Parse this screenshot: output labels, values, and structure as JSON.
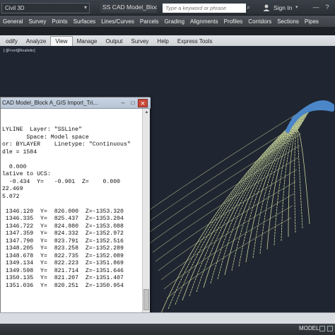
{
  "titlebar": {
    "workspace": "Civil 3D",
    "doc_title": "SS CAD Model_Bloc...",
    "search_placeholder": "Type a keyword or phrase",
    "signin": "Sign In"
  },
  "menubar": {
    "items": [
      "General",
      "Survey",
      "Points",
      "Surfaces",
      "Lines/Curves",
      "Parcels",
      "Grading",
      "Alignments",
      "Profiles",
      "Corridors",
      "Sections",
      "Pipes"
    ]
  },
  "ribbon": {
    "tabs": [
      "odify",
      "Analyze",
      "View",
      "Manage",
      "Output",
      "Survey",
      "Help",
      "Express Tools"
    ],
    "active_tab": "View"
  },
  "viewport": {
    "label": "[-][Front][Realistic]"
  },
  "text_window": {
    "title": "CAD Model_Block A_GIS Import_Tri...",
    "lines": [
      "",
      "",
      "LYLINE  Layer: \"SSLine\"",
      "       Space: Model space",
      "or: BYLAYER    Linetype: \"Continuous\"",
      "dle = 1584",
      "",
      "  0.000",
      "lative to UCS:",
      "  -0.434  Y=   -0.901  Z=    0.000",
      "22.469",
      "5.072",
      "",
      " 1346.120  Y=  826.000  Z=-1353.320",
      " 1346.335  Y=  825.437  Z=-1353.204",
      " 1346.722  Y=  824.880  Z=-1353.088",
      " 1347.359  Y=  824.332  Z=-1352.972",
      " 1347.790  Y=  823.791  Z=-1352.516",
      " 1348.205  Y=  823.258  Z=-1352.289",
      " 1348.678  Y=  822.735  Z=-1352.089",
      " 1349.134  Y=  822.223  Z=-1351.869",
      " 1349.598  Y=  821.714  Z=-1351.646",
      " 1350.135  Y=  821.207  Z=-1351.407",
      " 1351.036  Y=  820.251  Z=-1350.954"
    ]
  },
  "statusbar": {
    "model_label": "MODEL"
  },
  "colors": {
    "viewport_bg": "#1f2631",
    "contour_line": "#c8d49a",
    "highlight_line": "#4b86c8"
  },
  "icons": [
    "dropdown-chevron-icon",
    "search-icon",
    "user-icon",
    "minimize-icon",
    "help-icon",
    "close-icon",
    "maximize-icon",
    "scroll-up-icon",
    "scroll-down-icon"
  ]
}
